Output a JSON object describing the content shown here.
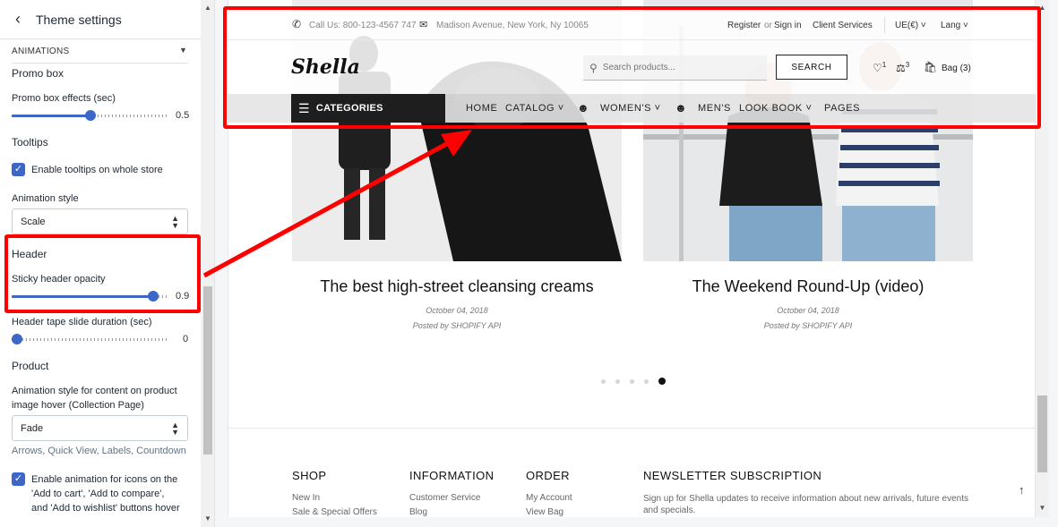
{
  "panel": {
    "title": "Theme settings",
    "sections": {
      "animations": "ANIMATIONS",
      "promo_box": "Promo box",
      "promo_effects_label": "Promo box effects (sec)",
      "promo_effects_value": "0.5",
      "promo_effects_fraction": 0.5,
      "tooltips": "Tooltips",
      "tooltips_checkbox": "Enable tooltips on whole store",
      "animation_style_label": "Animation style",
      "animation_style_value": "Scale",
      "header": "Header",
      "sticky_label": "Sticky header opacity",
      "sticky_value": "0.9",
      "sticky_fraction": 0.9,
      "tape_label": "Header tape slide duration (sec)",
      "tape_value": "0",
      "tape_fraction": 0.0,
      "product": "Product",
      "hover_label_1": "Animation style for content on product",
      "hover_label_2": "image hover (Collection Page)",
      "hover_value": "Fade",
      "hover_help": "Arrows, Quick View, Labels, Countdown",
      "icons_checkbox_1": "Enable animation for icons on the",
      "icons_checkbox_2": "'Add to cart', 'Add to compare',",
      "icons_checkbox_3": "and 'Add to wishlist' buttons hover"
    }
  },
  "header": {
    "phone": "Call Us: 800-123-4567 747",
    "address": "Madison Avenue, New York, Ny 10065",
    "register": "Register",
    "or": "or",
    "signin": "Sign in",
    "client_services": "Client Services",
    "currency": "UE(€)",
    "lang": "Lang",
    "logo": "Shella",
    "search_placeholder": "Search products...",
    "search_button": "SEARCH",
    "wishlist_count": "1",
    "compare_count": "3",
    "bag": "Bag (3)",
    "categories": "CATEGORIES",
    "nav": {
      "home": "HOME",
      "catalog": "CATALOG",
      "womens": "WOMEN'S",
      "mens": "MEN'S",
      "lookbook": "LOOK BOOK",
      "pages": "PAGES"
    }
  },
  "posts": [
    {
      "title": "The best high-street cleansing creams",
      "date": "October 04, 2018",
      "by": "Posted by SHOPIFY API"
    },
    {
      "title": "The Weekend Round-Up (video)",
      "date": "October 04, 2018",
      "by": "Posted by SHOPIFY API"
    }
  ],
  "footer": {
    "shop": {
      "heading": "SHOP",
      "links": [
        "New In",
        "Sale & Special Offers"
      ]
    },
    "information": {
      "heading": "INFORMATION",
      "links": [
        "Customer Service",
        "Blog"
      ]
    },
    "order": {
      "heading": "ORDER",
      "links": [
        "My Account",
        "View Bag"
      ]
    },
    "newsletter": {
      "heading": "NEWSLETTER SUBSCRIPTION",
      "text": "Sign up for Shella updates to receive information about new arrivals, future events and specials."
    }
  },
  "colors": {
    "annotation": "#ff0000",
    "accent": "#3c66c8"
  }
}
